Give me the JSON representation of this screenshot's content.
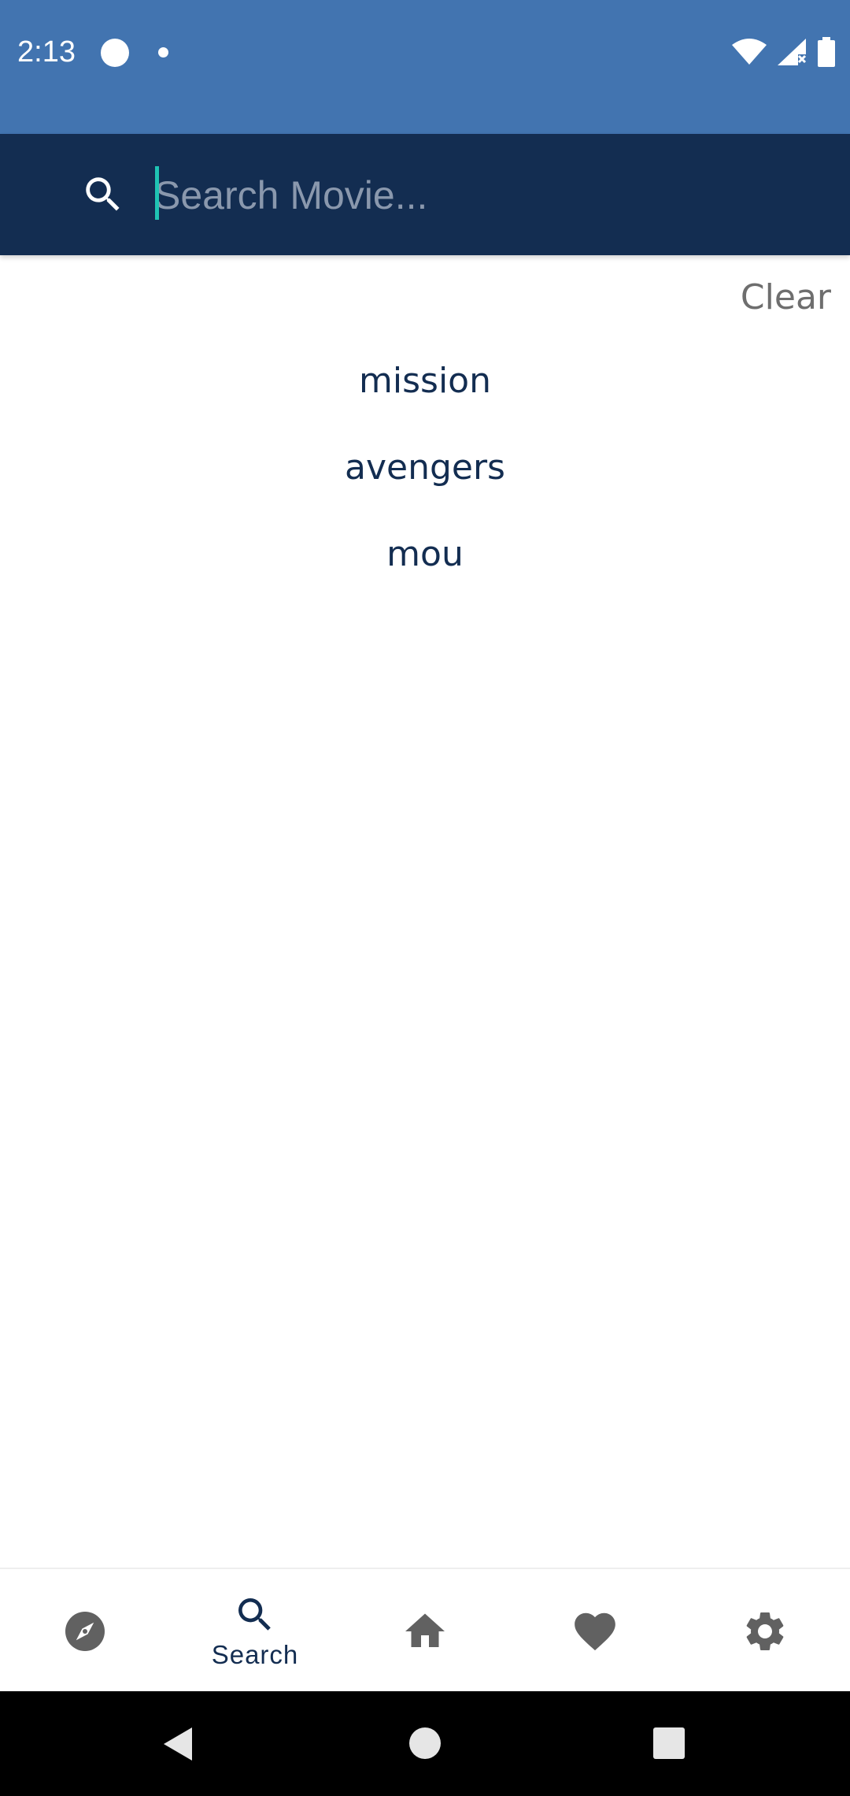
{
  "status_bar": {
    "time": "2:13"
  },
  "search": {
    "placeholder": "Search Movie...",
    "value": ""
  },
  "history": {
    "clear_label": "Clear",
    "items": [
      "mission",
      "avengers",
      "mou"
    ]
  },
  "bottom_nav": {
    "items": [
      {
        "id": "discover",
        "icon": "compass-icon",
        "label": ""
      },
      {
        "id": "search",
        "icon": "search-icon",
        "label": "Search",
        "active": true
      },
      {
        "id": "home",
        "icon": "home-icon",
        "label": ""
      },
      {
        "id": "favorites",
        "icon": "heart-icon",
        "label": ""
      },
      {
        "id": "settings",
        "icon": "gear-icon",
        "label": ""
      }
    ]
  },
  "colors": {
    "status_bar": "#4274b0",
    "header": "#132d51",
    "accent_caret": "#1fc3b3",
    "inactive_icon": "#616161",
    "active_icon": "#132d51"
  }
}
